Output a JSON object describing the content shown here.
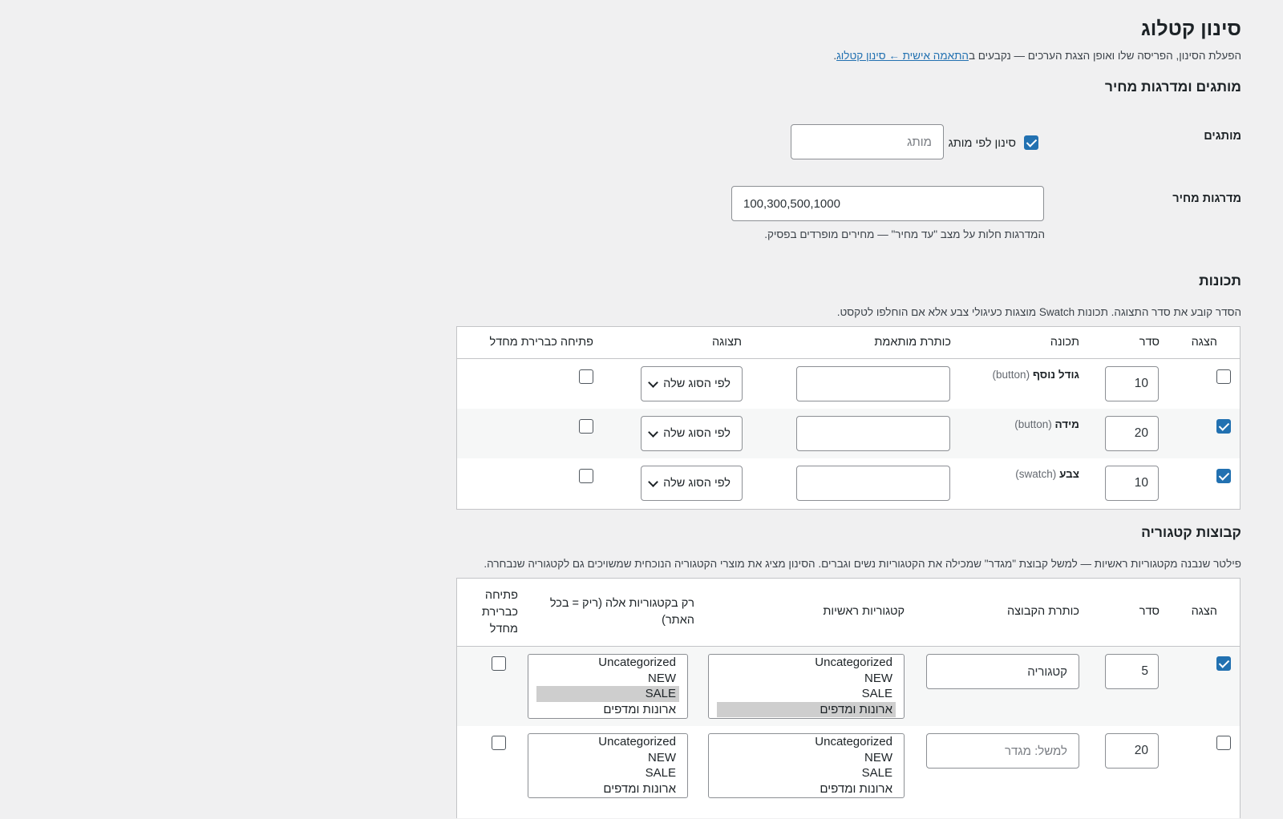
{
  "page": {
    "title": "סינון קטלוג",
    "description_prefix": "הפעלת הסינון, הפריסה שלו ואופן הצגת הערכים — נקבעים ב",
    "description_link": "התאמה אישית ← סינון קטלוג",
    "description_suffix": "."
  },
  "brands_section": {
    "heading": "מותגים ומדרגות מחיר",
    "brands_label": "מותגים",
    "brand_filter_checkbox_label": "סינון לפי מותג",
    "brand_filter_checked": true,
    "brand_input_placeholder": "מותג",
    "price_label": "מדרגות מחיר",
    "price_value": "100,300,500,1000",
    "price_help": "המדרגות חלות על מצב \"עד מחיר\" — מחירים מופרדים בפסיק."
  },
  "attributes_section": {
    "heading": "תכונות",
    "description": "הסדר קובע את סדר התצוגה. תכונות Swatch מוצגות כעיגולי צבע אלא אם הוחלפו לטקסט.",
    "columns": {
      "show": "הצגה",
      "order": "סדר",
      "attribute": "תכונה",
      "custom_title": "כותרת מותאמת",
      "display": "תצוגה",
      "open_default": "פתיחה כברירת מחדל"
    },
    "rows": [
      {
        "show": false,
        "order": "10",
        "name": "גודל נוסף",
        "type": "(button)",
        "custom_title": "",
        "display": "לפי הסוג שלה",
        "open_default": false
      },
      {
        "show": true,
        "order": "20",
        "name": "מידה",
        "type": "(button)",
        "custom_title": "",
        "display": "לפי הסוג שלה",
        "open_default": false
      },
      {
        "show": true,
        "order": "10",
        "name": "צבע",
        "type": "(swatch)",
        "custom_title": "",
        "display": "לפי הסוג שלה",
        "open_default": false
      }
    ]
  },
  "groups_section": {
    "heading": "קבוצות קטגוריה",
    "description": "פילטר שנבנה מקטגוריות ראשיות — למשל קבוצת \"מגדר\" שמכילה את הקטגוריות נשים וגברים. הסינון מציג את מוצרי הקטגוריה הנוכחית שמשויכים גם לקטגוריה שנבחרה.",
    "columns": {
      "show": "הצגה",
      "order": "סדר",
      "group_title": "כותרת הקבוצה",
      "parent_categories": "קטגוריות ראשיות",
      "only_in": "רק בקטגוריות אלה (ריק = בכל האתר)",
      "open_default": "פתיחה כברירת מחדל"
    },
    "rows": [
      {
        "show": true,
        "order": "5",
        "group_title": "קטגוריה",
        "group_title_placeholder": "",
        "parent_options": [
          "Uncategorized",
          "NEW",
          "SALE",
          "ארונות ומדפים"
        ],
        "parent_selected": [
          3
        ],
        "only_options": [
          "Uncategorized",
          "NEW",
          "SALE",
          "ארונות ומדפים"
        ],
        "only_selected": [
          2
        ],
        "open_default": false
      },
      {
        "show": false,
        "order": "20",
        "group_title": "",
        "group_title_placeholder": "למשל: מגדר",
        "parent_options": [
          "Uncategorized",
          "NEW",
          "SALE",
          "ארונות ומדפים"
        ],
        "parent_selected": [],
        "only_options": [
          "Uncategorized",
          "NEW",
          "SALE",
          "ארונות ומדפים"
        ],
        "only_selected": [],
        "open_default": false
      }
    ]
  },
  "colors": {
    "accent": "#2271b1",
    "background": "#f0f0f1",
    "text": "#1d2327"
  }
}
